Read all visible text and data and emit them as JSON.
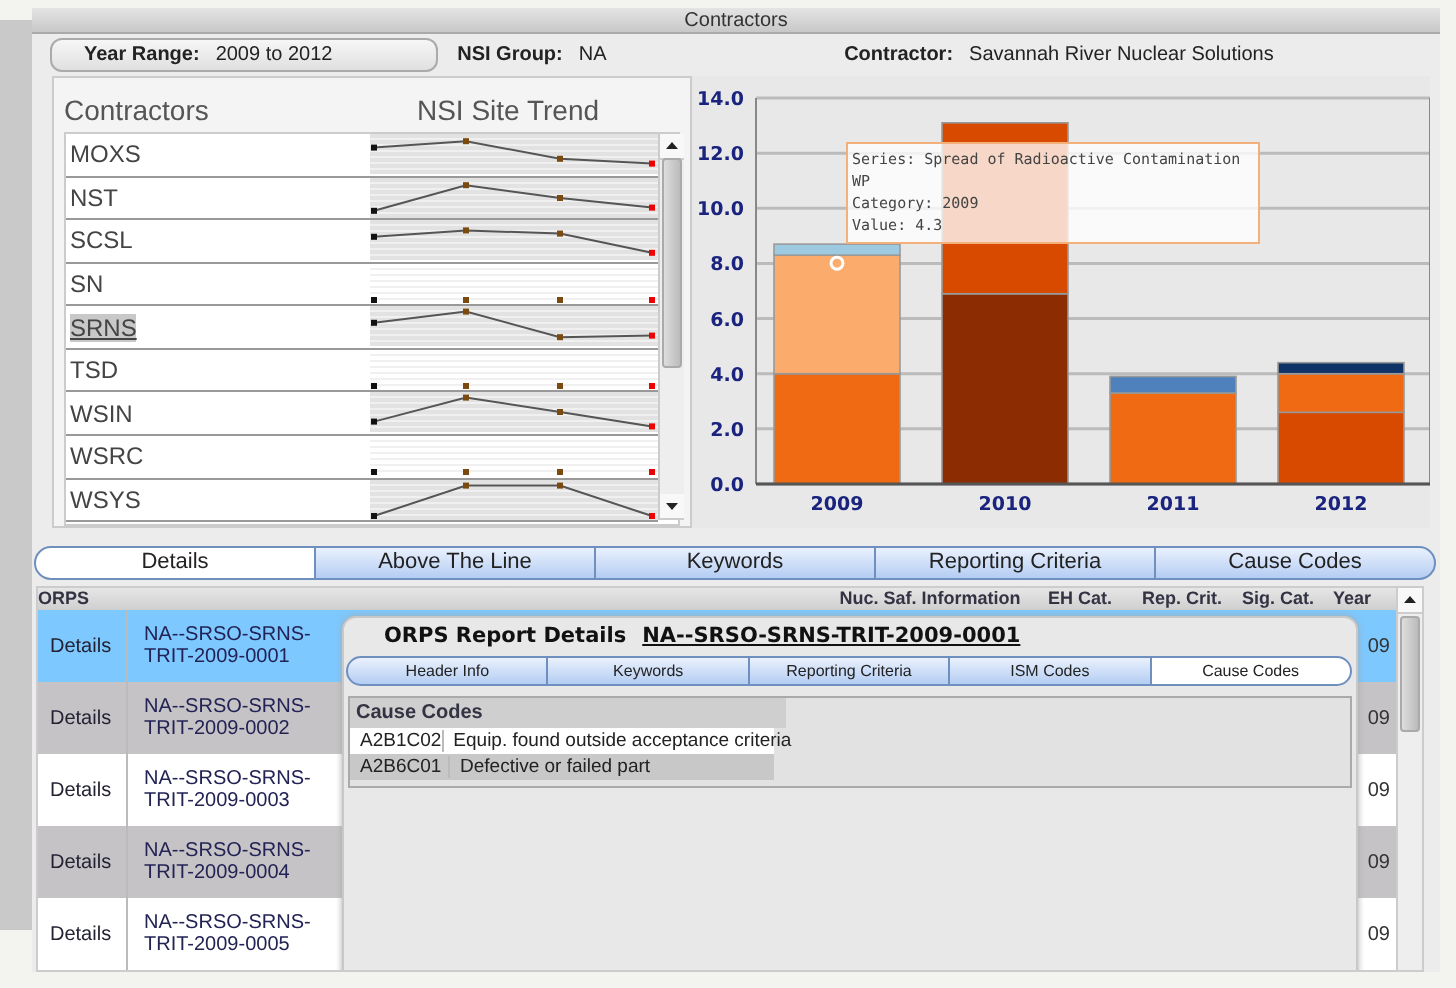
{
  "window": {
    "title": "Contractors"
  },
  "filters": [
    {
      "label": "Year Range:",
      "value": "2009 to 2012"
    },
    {
      "label": "NSI Group:",
      "value": "NA"
    },
    {
      "label": "Contractor:",
      "value": "Savannah River Nuclear Solutions"
    }
  ],
  "contractors_panel": {
    "columns": [
      "Contractors",
      "NSI Site Trend"
    ],
    "items": [
      {
        "name": "MOXS",
        "selected": false
      },
      {
        "name": "NST",
        "selected": false
      },
      {
        "name": "SCSL",
        "selected": false
      },
      {
        "name": "SN",
        "selected": false
      },
      {
        "name": "SRNS",
        "selected": true
      },
      {
        "name": "TSD",
        "selected": false
      },
      {
        "name": "WSIN",
        "selected": false
      },
      {
        "name": "WSRC",
        "selected": false
      },
      {
        "name": "WSYS",
        "selected": false
      }
    ]
  },
  "chart": {
    "chart_data": {
      "type": "bar",
      "stacked": true,
      "grid": true,
      "categories": [
        "2009",
        "2010",
        "2011",
        "2012"
      ],
      "ylim": [
        0,
        14
      ],
      "yticks": [
        {
          "value": 0,
          "label": "0.0"
        },
        {
          "value": 2,
          "label": "2.0"
        },
        {
          "value": 4,
          "label": "4.0"
        },
        {
          "value": 6,
          "label": "6.0"
        },
        {
          "value": 8,
          "label": "8.0"
        },
        {
          "value": 10,
          "label": "10.0"
        },
        {
          "value": 12,
          "label": "12.0"
        },
        {
          "value": 14,
          "label": "14.0"
        }
      ],
      "series": [
        {
          "color": "#8b2c02",
          "values": [
            null,
            6.9,
            null,
            null
          ]
        },
        {
          "color": "#d84a00",
          "values": [
            null,
            6.2,
            null,
            2.6
          ]
        },
        {
          "color": "#f06a14",
          "values": [
            4.0,
            null,
            3.3,
            1.4
          ]
        },
        {
          "name": "Spread of Radioactive Contamination WP",
          "color": "#fbab6b",
          "values": [
            4.3,
            null,
            null,
            null
          ]
        },
        {
          "color": "#9ecae1",
          "values": [
            0.4,
            null,
            null,
            null
          ]
        },
        {
          "color": "#4f81bd",
          "values": [
            null,
            null,
            0.6,
            null
          ]
        },
        {
          "color": "#0f3366",
          "values": [
            null,
            null,
            null,
            0.4
          ]
        }
      ]
    },
    "tooltip": {
      "series_label": "Series:",
      "lines": [
        "Category: 2009",
        "Value: 4.3"
      ]
    }
  },
  "tabs": [
    {
      "label": "Details",
      "selected": true
    },
    {
      "label": "Above The Line",
      "selected": false
    },
    {
      "label": "Keywords",
      "selected": false
    },
    {
      "label": "Reporting Criteria",
      "selected": false
    },
    {
      "label": "Cause Codes",
      "selected": false
    }
  ],
  "orps": {
    "title": "ORPS",
    "columns": [
      "Nuc. Saf. Information",
      "EH Cat.",
      "Rep. Crit.",
      "Sig. Cat.",
      "Year"
    ],
    "rows": [
      {
        "action": "Details",
        "id": "NA--SRSO-SRNS-TRIT-2009-0001",
        "year": "09",
        "selected": true
      },
      {
        "action": "Details",
        "id": "NA--SRSO-SRNS-TRIT-2009-0002",
        "year": "09",
        "selected": false
      },
      {
        "action": "Details",
        "id": "NA--SRSO-SRNS-TRIT-2009-0003",
        "year": "09",
        "selected": false
      },
      {
        "action": "Details",
        "id": "NA--SRSO-SRNS-TRIT-2009-0004",
        "year": "09",
        "selected": false
      },
      {
        "action": "Details",
        "id": "NA--SRSO-SRNS-TRIT-2009-0005",
        "year": "09",
        "selected": false
      }
    ]
  },
  "report": {
    "title": "ORPS Report Details",
    "link": "NA--SRSO-SRNS-TRIT-2009-0001",
    "tabs": [
      {
        "label": "Header Info",
        "selected": false
      },
      {
        "label": "Keywords",
        "selected": false
      },
      {
        "label": "Reporting Criteria",
        "selected": false
      },
      {
        "label": "ISM Codes",
        "selected": false
      },
      {
        "label": "Cause Codes",
        "selected": true
      }
    ],
    "cause_codes": {
      "title": "Cause Codes",
      "rows": [
        {
          "code": "A2B1C02",
          "description": "Equip. found outside acceptance criteria"
        },
        {
          "code": "A2B6C01",
          "description": "Defective or failed part"
        }
      ]
    }
  }
}
